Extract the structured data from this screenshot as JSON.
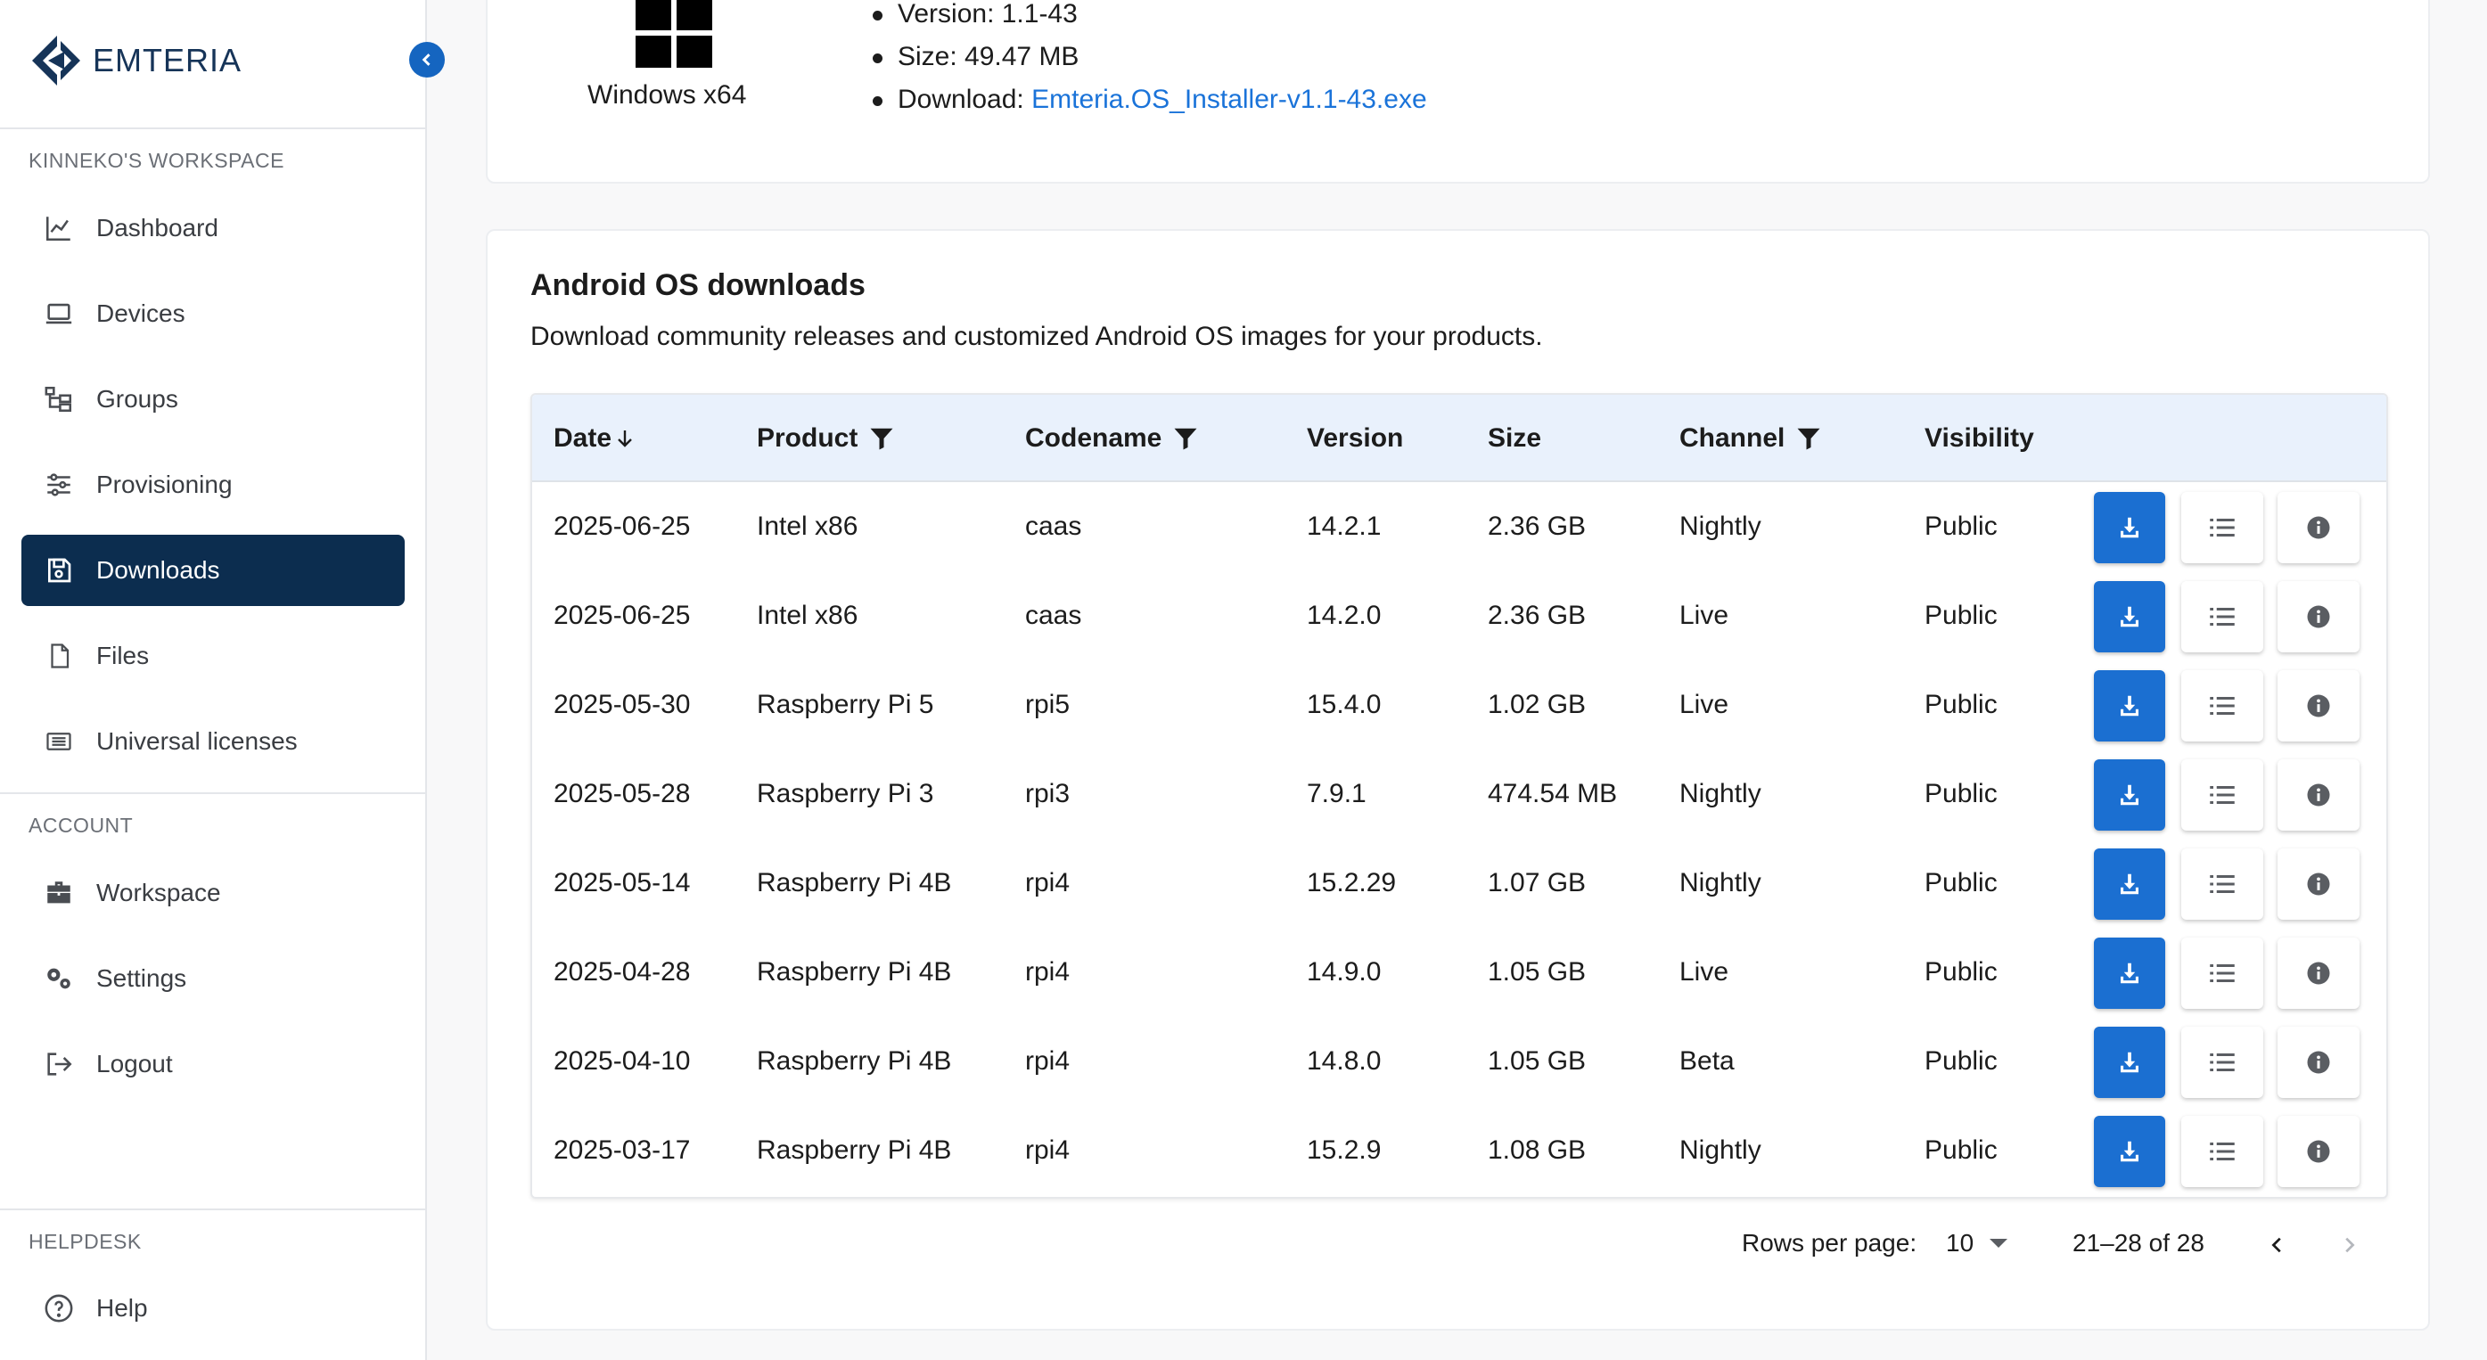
{
  "brand": {
    "name": "EMTERIA"
  },
  "sidebar": {
    "workspace_heading": "KINNEKO'S WORKSPACE",
    "items": [
      {
        "label": "Dashboard",
        "icon": "chart-line-icon"
      },
      {
        "label": "Devices",
        "icon": "laptop-icon"
      },
      {
        "label": "Groups",
        "icon": "groups-tree-icon"
      },
      {
        "label": "Provisioning",
        "icon": "sliders-icon"
      },
      {
        "label": "Downloads",
        "icon": "save-icon",
        "active": true
      },
      {
        "label": "Files",
        "icon": "file-icon"
      },
      {
        "label": "Universal licenses",
        "icon": "license-card-icon"
      }
    ],
    "account_heading": "ACCOUNT",
    "account_items": [
      {
        "label": "Workspace",
        "icon": "briefcase-icon"
      },
      {
        "label": "Settings",
        "icon": "gears-icon"
      },
      {
        "label": "Logout",
        "icon": "logout-icon"
      }
    ],
    "helpdesk_heading": "HELPDESK",
    "help_item": {
      "label": "Help",
      "icon": "help-circle-icon"
    }
  },
  "installer": {
    "platform_label": "Windows x64",
    "version": "Version: 1.1-43",
    "size": "Size: 49.47 MB",
    "download_prefix": "Download:",
    "download_link": "Emteria.OS_Installer-v1.1-43.exe"
  },
  "downloads": {
    "title": "Android OS downloads",
    "description": "Download community releases and customized Android OS images for your products.",
    "columns": {
      "date": "Date",
      "product": "Product",
      "codename": "Codename",
      "version": "Version",
      "size": "Size",
      "channel": "Channel",
      "visibility": "Visibility"
    },
    "rows": [
      {
        "date": "2025-06-25",
        "product": "Intel x86",
        "codename": "caas",
        "version": "14.2.1",
        "size": "2.36 GB",
        "channel": "Nightly",
        "visibility": "Public"
      },
      {
        "date": "2025-06-25",
        "product": "Intel x86",
        "codename": "caas",
        "version": "14.2.0",
        "size": "2.36 GB",
        "channel": "Live",
        "visibility": "Public"
      },
      {
        "date": "2025-05-30",
        "product": "Raspberry Pi 5",
        "codename": "rpi5",
        "version": "15.4.0",
        "size": "1.02 GB",
        "channel": "Live",
        "visibility": "Public"
      },
      {
        "date": "2025-05-28",
        "product": "Raspberry Pi 3",
        "codename": "rpi3",
        "version": "7.9.1",
        "size": "474.54 MB",
        "channel": "Nightly",
        "visibility": "Public"
      },
      {
        "date": "2025-05-14",
        "product": "Raspberry Pi 4B",
        "codename": "rpi4",
        "version": "15.2.29",
        "size": "1.07 GB",
        "channel": "Nightly",
        "visibility": "Public"
      },
      {
        "date": "2025-04-28",
        "product": "Raspberry Pi 4B",
        "codename": "rpi4",
        "version": "14.9.0",
        "size": "1.05 GB",
        "channel": "Live",
        "visibility": "Public"
      },
      {
        "date": "2025-04-10",
        "product": "Raspberry Pi 4B",
        "codename": "rpi4",
        "version": "14.8.0",
        "size": "1.05 GB",
        "channel": "Beta",
        "visibility": "Public"
      },
      {
        "date": "2025-03-17",
        "product": "Raspberry Pi 4B",
        "codename": "rpi4",
        "version": "15.2.9",
        "size": "1.08 GB",
        "channel": "Nightly",
        "visibility": "Public"
      }
    ],
    "pagination": {
      "rows_per_page_label": "Rows per page:",
      "rows_per_page_value": "10",
      "range": "21–28 of 28"
    }
  },
  "colors": {
    "brand_navy": "#163458",
    "active_nav": "#0c2d4f",
    "primary_blue": "#1b6fd1",
    "table_header_bg": "#e9f1fc",
    "link": "#1a73d9"
  }
}
